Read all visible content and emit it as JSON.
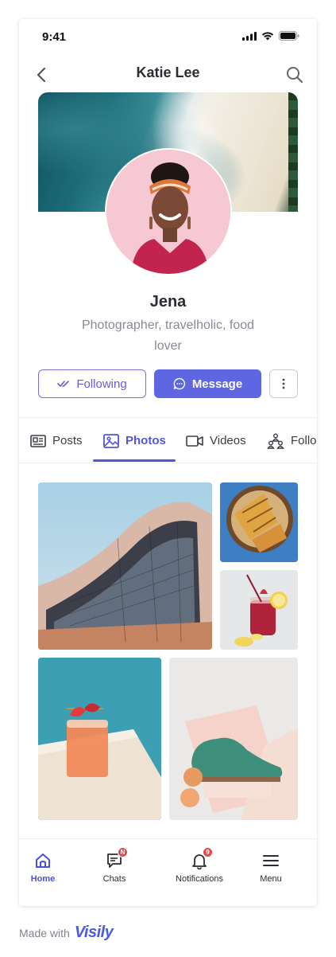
{
  "status": {
    "time": "9:41"
  },
  "header": {
    "title": "Katie Lee"
  },
  "profile": {
    "name": "Jena",
    "bio": "Photographer, travelholic, food lover"
  },
  "actions": {
    "following_label": "Following",
    "message_label": "Message"
  },
  "tabs": [
    {
      "label": "Posts",
      "icon": "newspaper-icon"
    },
    {
      "label": "Photos",
      "icon": "image-icon",
      "active": true
    },
    {
      "label": "Videos",
      "icon": "video-icon"
    },
    {
      "label": "Follo",
      "icon": "people-icon"
    }
  ],
  "bottom_nav": [
    {
      "label": "Home",
      "icon": "home-icon",
      "active": true
    },
    {
      "label": "Chats",
      "icon": "chat-icon",
      "badge": "N"
    },
    {
      "label": "Notifications",
      "icon": "bell-icon",
      "badge": "9"
    },
    {
      "label": "Menu",
      "icon": "menu-icon"
    }
  ],
  "footer": {
    "made_with": "Made with",
    "brand": "Visily"
  },
  "colors": {
    "accent": "#5f66e2",
    "active_tab": "#5057d8",
    "badge": "#e5484d"
  }
}
